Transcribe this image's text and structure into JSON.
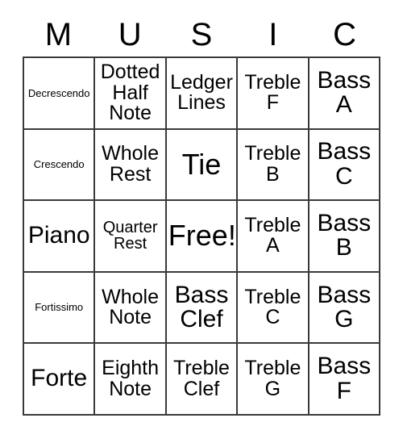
{
  "card": {
    "title_letters": [
      "M",
      "U",
      "S",
      "I",
      "C"
    ],
    "rows": [
      [
        {
          "text": "Decrescendo",
          "size": "xs"
        },
        {
          "text": "Dotted\nHalf\nNote",
          "size": "md"
        },
        {
          "text": "Ledger\nLines",
          "size": "md"
        },
        {
          "text": "Treble\nF",
          "size": "md"
        },
        {
          "text": "Bass\nA",
          "size": "lg"
        }
      ],
      [
        {
          "text": "Crescendo",
          "size": "xs"
        },
        {
          "text": "Whole\nRest",
          "size": "md"
        },
        {
          "text": "Tie",
          "size": "xl"
        },
        {
          "text": "Treble\nB",
          "size": "md"
        },
        {
          "text": "Bass\nC",
          "size": "lg"
        }
      ],
      [
        {
          "text": "Piano",
          "size": "lg"
        },
        {
          "text": "Quarter\nRest",
          "size": "sm"
        },
        {
          "text": "Free!",
          "size": "xl"
        },
        {
          "text": "Treble\nA",
          "size": "md"
        },
        {
          "text": "Bass\nB",
          "size": "lg"
        }
      ],
      [
        {
          "text": "Fortissimo",
          "size": "xs"
        },
        {
          "text": "Whole\nNote",
          "size": "md"
        },
        {
          "text": "Bass\nClef",
          "size": "lg"
        },
        {
          "text": "Treble\nC",
          "size": "md"
        },
        {
          "text": "Bass\nG",
          "size": "lg"
        }
      ],
      [
        {
          "text": "Forte",
          "size": "lg"
        },
        {
          "text": "Eighth\nNote",
          "size": "md"
        },
        {
          "text": "Treble\nClef",
          "size": "md"
        },
        {
          "text": "Treble\nG",
          "size": "md"
        },
        {
          "text": "Bass\nF",
          "size": "lg"
        }
      ]
    ]
  },
  "colors": {
    "border": "#3a3a3a",
    "text": "#000000",
    "background": "#ffffff"
  }
}
